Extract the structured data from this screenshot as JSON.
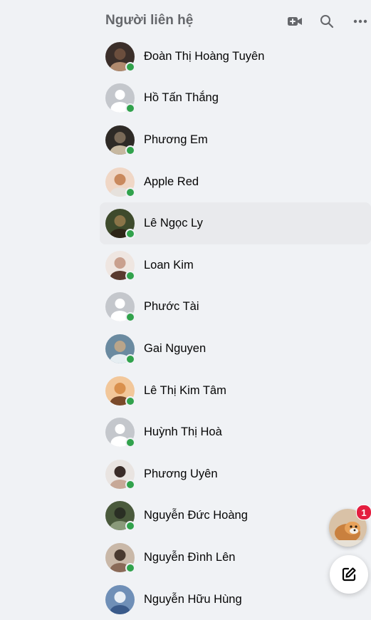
{
  "header": {
    "title": "Người liên hệ",
    "icons": [
      "video-call-icon",
      "search-icon",
      "more-options-icon"
    ]
  },
  "contacts": [
    {
      "name": "Đoàn Thị Hoàng Tuyên",
      "online": true,
      "avatar": "photo"
    },
    {
      "name": "Hồ Tấn Thắng",
      "online": true,
      "avatar": "default"
    },
    {
      "name": "Phương Em",
      "online": true,
      "avatar": "photo"
    },
    {
      "name": "Apple Red",
      "online": true,
      "avatar": "photo"
    },
    {
      "name": "Lê Ngọc Ly",
      "online": true,
      "avatar": "photo"
    },
    {
      "name": "Loan Kim",
      "online": true,
      "avatar": "photo"
    },
    {
      "name": "Phước Tài",
      "online": true,
      "avatar": "default"
    },
    {
      "name": "Gai Nguyen",
      "online": true,
      "avatar": "photo"
    },
    {
      "name": "Lê Thị Kim Tâm",
      "online": true,
      "avatar": "photo"
    },
    {
      "name": "Huỳnh Thị Hoà",
      "online": true,
      "avatar": "default"
    },
    {
      "name": "Phương Uyên",
      "online": true,
      "avatar": "photo"
    },
    {
      "name": "Nguyễn Đức Hoàng",
      "online": true,
      "avatar": "photo"
    },
    {
      "name": "Nguyễn Đình Lên",
      "online": true,
      "avatar": "photo"
    },
    {
      "name": "Nguyễn Hữu Hùng",
      "online": false,
      "avatar": "photo"
    }
  ],
  "floating": {
    "chat_badge_count": "1",
    "compose_icon": "new-message-icon"
  },
  "colors": {
    "background": "#f0f2f5",
    "online_dot": "#31a24c",
    "badge": "#e41e3f",
    "title": "#65676b"
  }
}
